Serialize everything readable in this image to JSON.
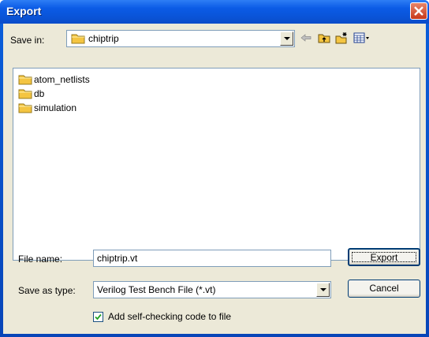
{
  "window": {
    "title": "Export"
  },
  "header": {
    "save_in_label": "Save in:",
    "save_in_value": "chiptrip"
  },
  "toolbar": {
    "icons": [
      "back-arrow-icon",
      "up-folder-icon",
      "new-folder-icon",
      "view-menu-icon"
    ]
  },
  "files": [
    {
      "name": "atom_netlists"
    },
    {
      "name": "db"
    },
    {
      "name": "simulation"
    }
  ],
  "form": {
    "file_name_label": "File name:",
    "file_name_value": "chiptrip.vt",
    "save_as_type_label": "Save as type:",
    "save_as_type_value": "Verilog Test Bench File (*.vt)",
    "checkbox_label": "Add self-checking code to file",
    "checkbox_checked": true
  },
  "buttons": {
    "export": "Export",
    "cancel": "Cancel"
  },
  "colors": {
    "title_bar": "#0a5fdc",
    "client_bg": "#ece9d8",
    "folder": "#f4c542"
  }
}
